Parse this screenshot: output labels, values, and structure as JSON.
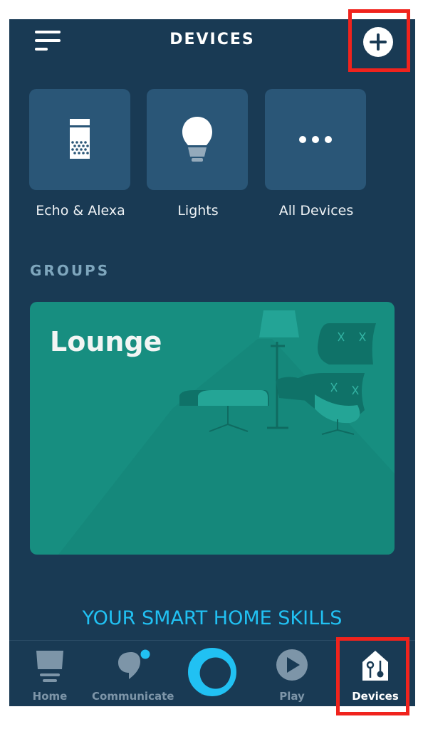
{
  "header": {
    "title": "DEVICES",
    "menu_icon": "hamburger-menu-icon",
    "add_icon": "plus-circle-icon"
  },
  "device_categories": [
    {
      "label": "Echo & Alexa",
      "icon": "echo-speaker-icon"
    },
    {
      "label": "Lights",
      "icon": "light-bulb-icon"
    },
    {
      "label": "All Devices",
      "icon": "more-dots-icon"
    }
  ],
  "groups": {
    "heading": "GROUPS",
    "items": [
      {
        "name": "Lounge",
        "illustration": "lounge-chair-lamp-illustration"
      }
    ]
  },
  "skills_link": "YOUR SMART HOME SKILLS",
  "tabbar": {
    "tabs": [
      {
        "label": "Home",
        "icon": "home-icon",
        "active": false
      },
      {
        "label": "Communicate",
        "icon": "chat-bubble-icon",
        "active": false,
        "badge": true
      },
      {
        "label": "",
        "icon": "alexa-ring-icon",
        "active": false
      },
      {
        "label": "Play",
        "icon": "play-icon",
        "active": false
      },
      {
        "label": "Devices",
        "icon": "devices-house-icon",
        "active": true
      }
    ]
  },
  "colors": {
    "background": "#193a54",
    "tile": "#2a5677",
    "group_card": "#178e80",
    "accent": "#21c1f3",
    "inactive_tab": "#7d95a8",
    "annotation": "#f0231d"
  }
}
